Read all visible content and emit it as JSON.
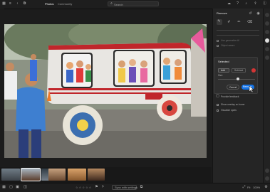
{
  "topbar": {
    "tabs": [
      "Photos",
      "Community"
    ],
    "search_placeholder": "Search"
  },
  "panel": {
    "title": "Remove",
    "use_generative_ai": "Use generative AI",
    "object_aware": "Object aware",
    "popup_title": "Selected",
    "add_label": "Add",
    "subtract_label": "Subtract",
    "size_label": "Size",
    "cancel_label": "Cancel",
    "remove_label": "Remove",
    "provide_feedback": "Provide feedback",
    "show_overlay": "Show overlay on hover",
    "visualize_spots": "Visualize spots"
  },
  "bottombar": {
    "rating_label": "☆ ☆ ☆ ☆ ☆",
    "sync_label": "Sync with settings",
    "fit_label": "Fit",
    "percent_label": "100%"
  },
  "colors": {
    "accent": "#1473e6",
    "bus_body": "#e8e6e2",
    "bus_red": "#c0262b",
    "red_dot": "#d33535"
  }
}
